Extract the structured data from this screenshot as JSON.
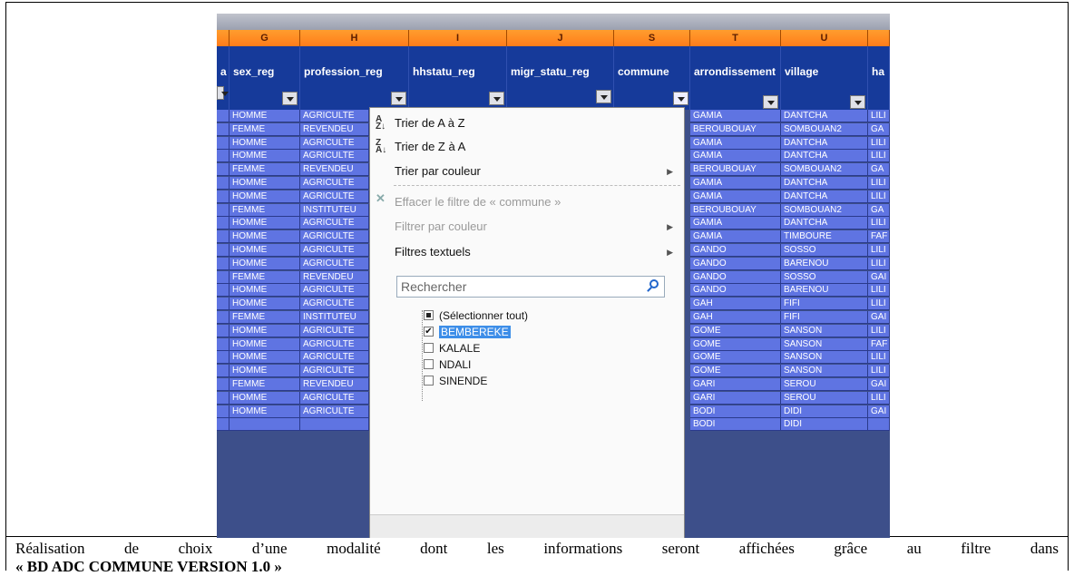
{
  "columns": [
    {
      "letter": "G",
      "field": "sex_reg"
    },
    {
      "letter": "H",
      "field": "profession_reg"
    },
    {
      "letter": "I",
      "field": "hhstatu_reg"
    },
    {
      "letter": "J",
      "field": "migr_statu_reg"
    },
    {
      "letter": "S",
      "field": "commune"
    },
    {
      "letter": "T",
      "field": "arrondissement"
    },
    {
      "letter": "U",
      "field": "village"
    },
    {
      "letter": "",
      "field": "ha"
    }
  ],
  "left_partial_field": "a",
  "rows": [
    {
      "sex": "HOMME",
      "prof": "AGRICULTE",
      "arr": "GAMIA",
      "vil": "DANTCHA",
      "ha": "LILI"
    },
    {
      "sex": "FEMME",
      "prof": "REVENDEU",
      "arr": "BEROUBOUAY",
      "vil": "SOMBOUAN2",
      "ha": "GA"
    },
    {
      "sex": "HOMME",
      "prof": "AGRICULTE",
      "arr": "GAMIA",
      "vil": "DANTCHA",
      "ha": "LILI"
    },
    {
      "sex": "HOMME",
      "prof": "AGRICULTE",
      "arr": "GAMIA",
      "vil": "DANTCHA",
      "ha": "LILI"
    },
    {
      "sex": "FEMME",
      "prof": "REVENDEU",
      "arr": "BEROUBOUAY",
      "vil": "SOMBOUAN2",
      "ha": "GA"
    },
    {
      "sex": "HOMME",
      "prof": "AGRICULTE",
      "arr": "GAMIA",
      "vil": "DANTCHA",
      "ha": "LILI"
    },
    {
      "sex": "HOMME",
      "prof": "AGRICULTE",
      "arr": "GAMIA",
      "vil": "DANTCHA",
      "ha": "LILI"
    },
    {
      "sex": "FEMME",
      "prof": "INSTITUTEU",
      "arr": "BEROUBOUAY",
      "vil": "SOMBOUAN2",
      "ha": "GA"
    },
    {
      "sex": "HOMME",
      "prof": "AGRICULTE",
      "arr": "GAMIA",
      "vil": "DANTCHA",
      "ha": "LILI"
    },
    {
      "sex": "HOMME",
      "prof": "AGRICULTE",
      "arr": "GAMIA",
      "vil": "TIMBOURE",
      "ha": "FAF"
    },
    {
      "sex": "HOMME",
      "prof": "AGRICULTE",
      "arr": "GANDO",
      "vil": "SOSSO",
      "ha": "LILI"
    },
    {
      "sex": "HOMME",
      "prof": "AGRICULTE",
      "arr": "GANDO",
      "vil": "BARENOU",
      "ha": "LILI"
    },
    {
      "sex": "FEMME",
      "prof": "REVENDEU",
      "arr": "GANDO",
      "vil": "SOSSO",
      "ha": "GAI"
    },
    {
      "sex": "HOMME",
      "prof": "AGRICULTE",
      "arr": "GANDO",
      "vil": "BARENOU",
      "ha": "LILI"
    },
    {
      "sex": "HOMME",
      "prof": "AGRICULTE",
      "arr": "GAH",
      "vil": "FIFI",
      "ha": "LILI"
    },
    {
      "sex": "FEMME",
      "prof": "INSTITUTEU",
      "arr": "GAH",
      "vil": "FIFI",
      "ha": "GAI"
    },
    {
      "sex": "HOMME",
      "prof": "AGRICULTE",
      "arr": "GOME",
      "vil": "SANSON",
      "ha": "LILI"
    },
    {
      "sex": "HOMME",
      "prof": "AGRICULTE",
      "arr": "GOME",
      "vil": "SANSON",
      "ha": "FAF"
    },
    {
      "sex": "HOMME",
      "prof": "AGRICULTE",
      "arr": "GOME",
      "vil": "SANSON",
      "ha": "LILI"
    },
    {
      "sex": "HOMME",
      "prof": "AGRICULTE",
      "arr": "GOME",
      "vil": "SANSON",
      "ha": "LILI"
    },
    {
      "sex": "FEMME",
      "prof": "REVENDEU",
      "arr": "GARI",
      "vil": "SEROU",
      "ha": "GAI"
    },
    {
      "sex": "HOMME",
      "prof": "AGRICULTE",
      "arr": "GARI",
      "vil": "SEROU",
      "ha": "LILI"
    },
    {
      "sex": "HOMME",
      "prof": "AGRICULTE",
      "arr": "BODI",
      "vil": "DIDI",
      "ha": "GAI"
    },
    {
      "sex": "",
      "prof": "",
      "arr": "BODI",
      "vil": "DIDI",
      "ha": ""
    }
  ],
  "menu": {
    "sort_az": "Trier de A à Z",
    "sort_za": "Trier de Z à A",
    "sort_color": "Trier par couleur",
    "clear_filter": "Effacer le filtre de « commune »",
    "filter_color": "Filtrer par couleur",
    "text_filters": "Filtres textuels",
    "search_placeholder": "Rechercher",
    "select_all": "(Sélectionner tout)",
    "items": [
      {
        "label": "BEMBEREKE",
        "checked": true
      },
      {
        "label": "KALALE",
        "checked": false
      },
      {
        "label": "NDALI",
        "checked": false
      },
      {
        "label": "SINENDE",
        "checked": false
      }
    ]
  },
  "caption": {
    "line1": "Réalisation de choix d’une modalité dont les informations seront affichées grâce au filtre dans",
    "line2": "« BD ADC COMMUNE VERSION 1.0 »"
  }
}
